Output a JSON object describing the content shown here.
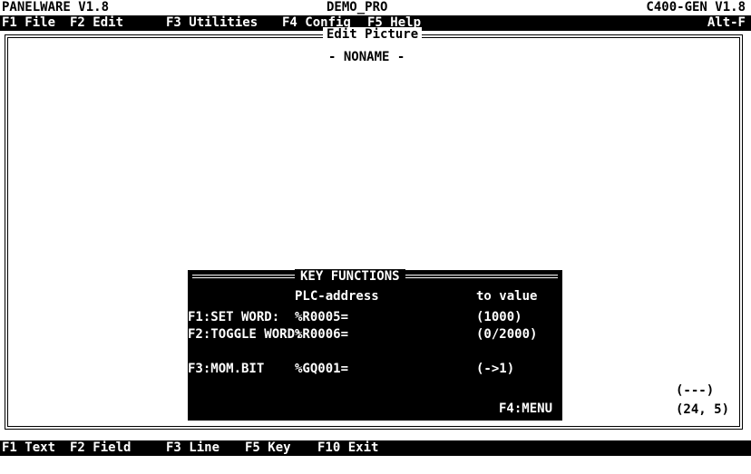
{
  "title_line": {
    "left": "PANELWARE V1.8",
    "center": "DEMO_PRO",
    "right": "C400-GEN V1.8"
  },
  "menu": {
    "items": [
      "F1 File",
      "F2 Edit",
      "F3 Utilities",
      "F4 Config",
      "F5 Help"
    ],
    "right": "Alt-F"
  },
  "editor": {
    "title": "Edit Picture",
    "document": "- NONAME -"
  },
  "key_functions": {
    "title": "KEY FUNCTIONS",
    "col_address": "PLC-address",
    "col_value": "to value",
    "rows": [
      {
        "label": "F1:SET WORD:",
        "address": "%R0005=",
        "value": "(1000)"
      },
      {
        "label": "F2:TOGGLE WORD:",
        "address": "%R0006=",
        "value": "(0/2000)"
      },
      {
        "label": "F3:MOM.BIT",
        "address": "%GQ001=",
        "value": "(->1)"
      }
    ],
    "menu_key": "F4:MENU"
  },
  "cursor": {
    "marker": "(---)",
    "position": "(24, 5)"
  },
  "function_keys": [
    "F1 Text",
    "F2 Field",
    "F3 Line",
    "F5 Key",
    "F10 Exit"
  ],
  "colors": {
    "background": "#ffffff",
    "foreground": "#000000",
    "bar": "#000000",
    "bar_text": "#ffffff"
  }
}
